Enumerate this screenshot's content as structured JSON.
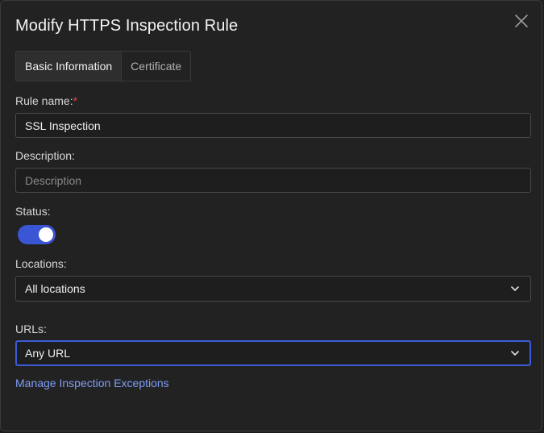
{
  "dialog": {
    "title": "Modify HTTPS Inspection Rule"
  },
  "tabs": [
    {
      "label": "Basic Information",
      "active": true
    },
    {
      "label": "Certificate",
      "active": false
    }
  ],
  "form": {
    "rule_name": {
      "label": "Rule name:",
      "required_marker": "*",
      "value": "SSL Inspection"
    },
    "description": {
      "label": "Description:",
      "value": "",
      "placeholder": "Description"
    },
    "status": {
      "label": "Status:",
      "enabled": true
    },
    "locations": {
      "label": "Locations:",
      "selected": "All locations"
    },
    "urls": {
      "label": "URLs:",
      "selected": "Any URL",
      "focused": true
    }
  },
  "links": {
    "manage_exceptions": "Manage Inspection Exceptions"
  },
  "colors": {
    "accent": "#3a56d4",
    "link": "#7f9cf5",
    "required": "#e5484d",
    "background": "#222222"
  },
  "icons": {
    "close": "close-icon",
    "dropdown": "chevron-down-icon"
  }
}
